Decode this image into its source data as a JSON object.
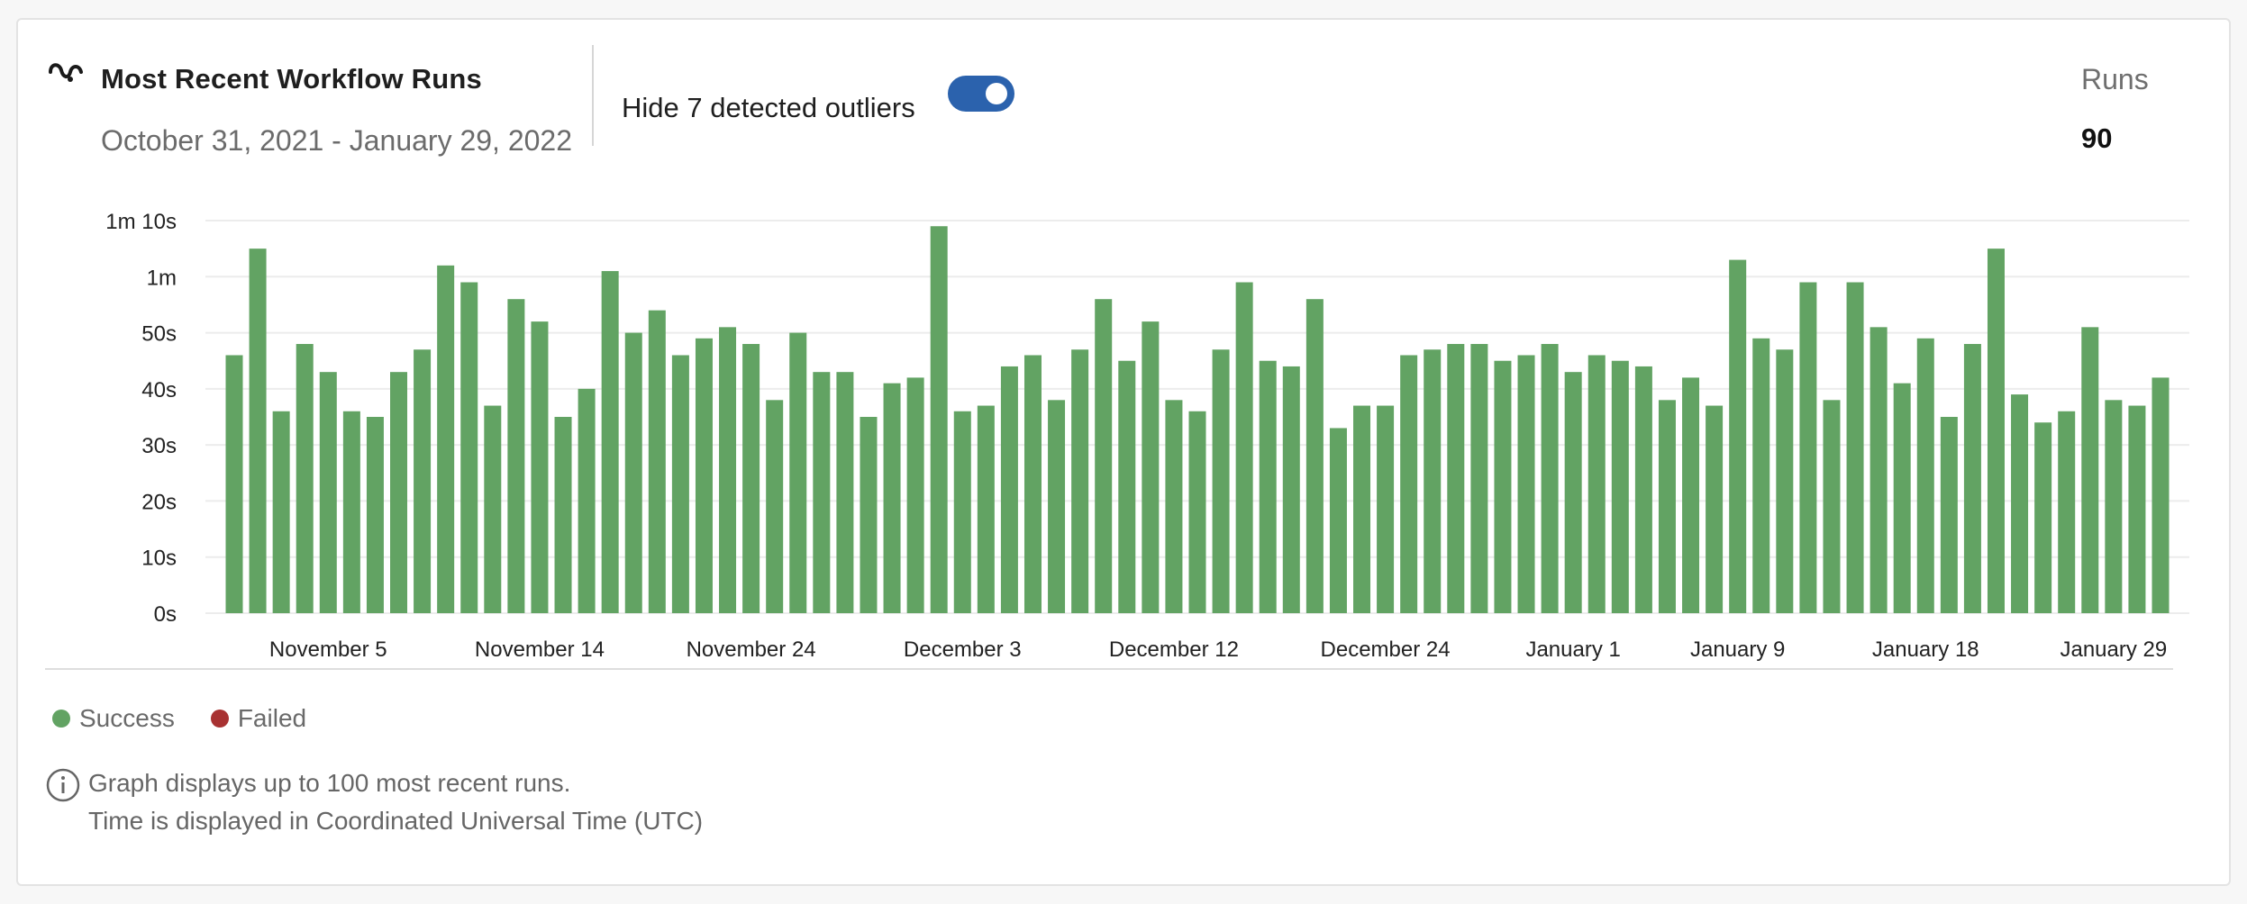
{
  "header": {
    "title": "Most Recent Workflow Runs",
    "date_range": "October 31, 2021 - January 29, 2022",
    "title_icon": "workflow-wave-icon"
  },
  "outliers": {
    "label": "Hide 7 detected outliers",
    "enabled": true
  },
  "summary": {
    "runs_label": "Runs",
    "runs_value": "90"
  },
  "legend": {
    "success_label": "Success",
    "failed_label": "Failed",
    "success_color": "#62a363",
    "failed_color": "#a83232"
  },
  "notes": {
    "line1": "Graph displays up to 100 most recent runs.",
    "line2": "Time is displayed in Coordinated Universal Time (UTC)",
    "icon": "info-icon"
  },
  "chart_data": {
    "type": "bar",
    "y_tick_labels": [
      "0s",
      "10s",
      "20s",
      "30s",
      "40s",
      "50s",
      "1m",
      "1m 10s"
    ],
    "y_ticks": [
      0,
      10,
      20,
      30,
      40,
      50,
      60,
      70
    ],
    "ylim": [
      0,
      70
    ],
    "y_unit": "seconds",
    "x_tick_labels": [
      "November 5",
      "November 14",
      "November 24",
      "December 3",
      "December 12",
      "December 24",
      "January 1",
      "January 9",
      "January 18",
      "January 29"
    ],
    "x_tick_run_index": [
      4,
      13,
      22,
      31,
      40,
      49,
      57,
      64,
      72,
      80
    ],
    "grid": true,
    "series": [
      {
        "name": "Success",
        "color": "#62a363",
        "values": [
          46,
          65,
          36,
          48,
          43,
          36,
          35,
          43,
          47,
          62,
          59,
          37,
          56,
          52,
          35,
          40,
          61,
          50,
          54,
          46,
          49,
          51,
          48,
          38,
          50,
          43,
          43,
          35,
          41,
          42,
          69,
          36,
          37,
          44,
          46,
          38,
          47,
          56,
          45,
          52,
          38,
          36,
          47,
          59,
          45,
          44,
          56,
          33,
          37,
          37,
          46,
          47,
          48,
          48,
          45,
          46,
          48,
          43,
          46,
          45,
          44,
          38,
          42,
          37,
          63,
          49,
          47,
          59,
          38,
          59,
          51,
          41,
          49,
          35,
          48,
          65,
          39,
          34,
          36,
          51,
          38,
          37,
          42
        ]
      },
      {
        "name": "Failed",
        "color": "#a83232",
        "values": []
      }
    ]
  }
}
